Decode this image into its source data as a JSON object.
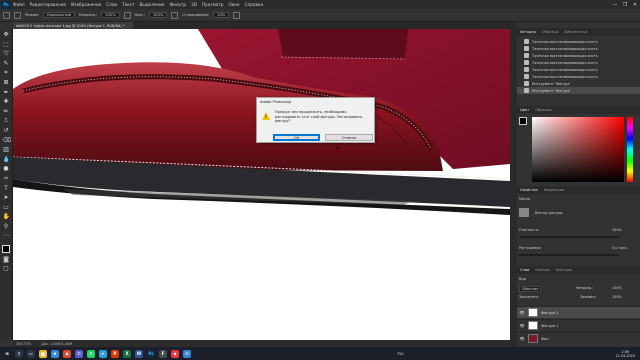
{
  "app": {
    "logo": "Ps",
    "title": "Adobe Photoshop"
  },
  "menu": [
    "Файл",
    "Редактирование",
    "Изображение",
    "Слои",
    "Текст",
    "Выделение",
    "Фильтр",
    "3D",
    "Просмотр",
    "Окно",
    "Справка"
  ],
  "window_controls": [
    "—",
    "❐",
    "✕"
  ],
  "options": {
    "mode_label": "Режим:",
    "mode_value": "Нормальный",
    "opacity_label": "Непрозр.:",
    "opacity_value": "100%",
    "flow_label": "Наж.:",
    "flow_value": "100%",
    "smoothing_label": "Сглаживание:",
    "smoothing_value": "10%"
  },
  "document": {
    "tab_title": "ddd076 5 туфли-женские 1.jpg @ 200% (Фигура 1, RGB/8#) *",
    "zoom": "200,73%",
    "doc_size": "Док: 1,65М/1,05М"
  },
  "dialog": {
    "title": "Adobe Photoshop",
    "message": "Прежде чем продолжить, необходимо растрировать этот слой фигуры. Растрировать фигуру?",
    "ok": "ОК",
    "cancel": "Отмена",
    "icon": "warning-icon"
  },
  "history": {
    "tabs": [
      "История",
      "Образцы",
      "Библиотеки"
    ],
    "items": [
      "Точечная восстанавливающая кисть",
      "Точечная восстанавливающая кисть",
      "Точечная восстанавливающая кисть",
      "Точечная восстанавливающая кисть",
      "Точечная восстанавливающая кисть",
      "Точечная восстанавливающая кисть",
      "Инструмент \"Фигура\"",
      "Инструмент \"Фигура\""
    ]
  },
  "color": {
    "tabs": [
      "Цвет",
      "Образцы"
    ]
  },
  "properties": {
    "tabs": [
      "Свойства",
      "Коррекция"
    ],
    "section": "Маска",
    "mask_label": "Вектор фигуры",
    "density_label": "Плотность:",
    "density_value": "100%",
    "feather_label": "Растушевка:",
    "feather_value": "0,0 пикс."
  },
  "layers": {
    "tabs": [
      "Слои",
      "Каналы",
      "Контуры"
    ],
    "filter_label": "Вид",
    "blend_mode": "Обычные",
    "opacity_label": "Непрозр.:",
    "opacity_value": "100%",
    "fill_label": "Заливка:",
    "fill_value": "100%",
    "lock_label": "Закрепить:",
    "rows": [
      {
        "name": "Фигура 2",
        "selected": true
      },
      {
        "name": "Фигура 1",
        "selected": false
      },
      {
        "name": "Фон",
        "selected": false
      }
    ]
  },
  "taskbar": {
    "lang": "РУС",
    "time": "2:06",
    "date": "11.04.2020"
  },
  "colors": {
    "accent": "#0078d7",
    "warning": "#f2c100",
    "shoe_leather": "#8b1420",
    "suede": "#9a1530"
  }
}
